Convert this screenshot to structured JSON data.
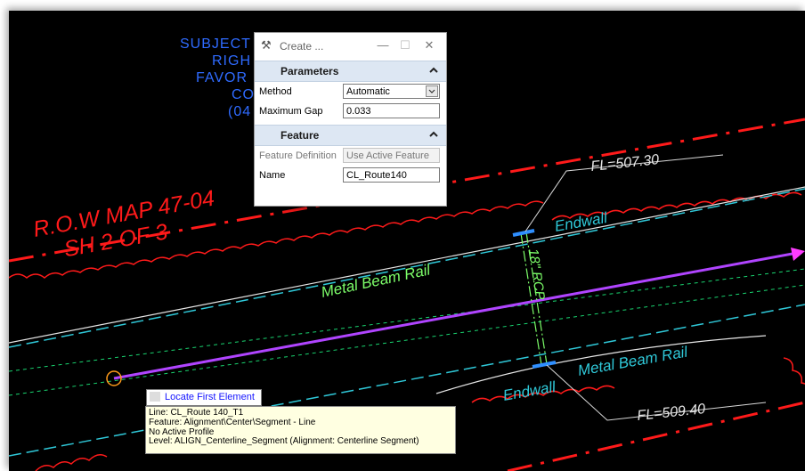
{
  "drawing": {
    "subject_lines": [
      "SUBJECT",
      "RIGH",
      "FAVOR",
      "CO",
      "(04"
    ],
    "row_map_line1": "R.O.W MAP 47-04",
    "row_map_line2": "SH 2 OF 3",
    "metal_beam_rail_upper": "Metal Beam Rail",
    "metal_beam_rail_lower": "Metal Beam Rail",
    "endwall_upper": "Endwall",
    "endwall_lower": "Endwall",
    "fl_upper": "FL=507.30",
    "fl_lower": "FL=509.40",
    "pipe_label": "18\" RCP"
  },
  "dialog": {
    "title": "Create ...",
    "minimize_glyph": "—",
    "maximize_glyph": "☐",
    "close_glyph": "✕",
    "parameters": {
      "header": "Parameters",
      "method_label": "Method",
      "method_value": "Automatic",
      "max_gap_label": "Maximum Gap",
      "max_gap_value": "0.033"
    },
    "feature": {
      "header": "Feature",
      "definition_label": "Feature Definition",
      "definition_value": "Use Active Feature",
      "name_label": "Name",
      "name_value": "CL_Route140"
    }
  },
  "prompt": {
    "text": "Locate First Element"
  },
  "tooltip": {
    "line1": "Line: CL_Route 140_T1",
    "line2": "Feature: Alignment\\Center\\Segment  -  Line",
    "line3": "No Active Profile",
    "line4": "Level: ALIGN_Centerline_Segment (Alignment: Centerline Segment)"
  },
  "colors": {
    "red": "#ff1a1a",
    "blue_text": "#2f6bff",
    "cyan": "#2fc8d8",
    "green": "#19d36f",
    "green_text": "#7dff6a",
    "purple": "#b044ff",
    "magenta_arrow": "#ff3cff",
    "white": "#ffffff",
    "orange": "#ff9a1a"
  }
}
